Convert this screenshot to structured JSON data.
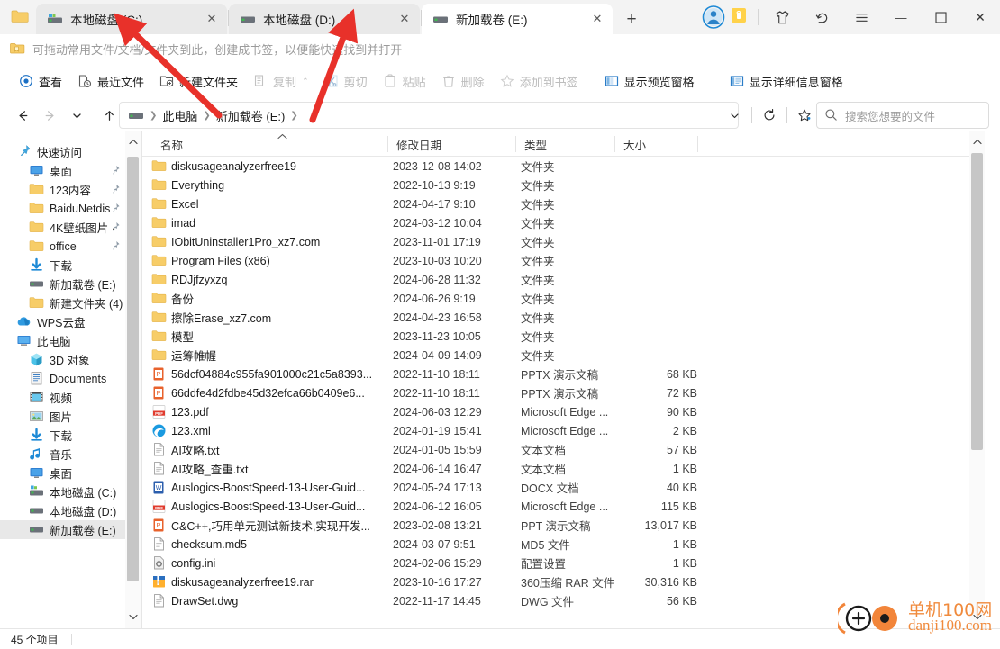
{
  "window": {
    "app_icon": "folder-icon",
    "controls": {
      "clothes": "shirt-icon",
      "undo": "undo-icon",
      "menu": "hamburger-menu-icon",
      "minimize": "—",
      "maximize": "▢",
      "close": "✕"
    }
  },
  "tabs": [
    {
      "label": "本地磁盘 (C:)",
      "icon": "drive-c-icon",
      "active": false,
      "close": "✕"
    },
    {
      "label": "本地磁盘 (D:)",
      "icon": "drive-d-icon",
      "active": false,
      "close": "✕"
    },
    {
      "label": "新加载卷 (E:)",
      "icon": "drive-e-icon",
      "active": true,
      "close": "✕"
    }
  ],
  "new_tab_label": "+",
  "bookmark_bar": {
    "icon": "bookmark-folder-icon",
    "text": "可拖动常用文件/文档/文件夹到此，创建成书签，以便能快速找到并打开"
  },
  "toolbar": [
    {
      "label": "查看",
      "icon": "view-icon",
      "disabled": false,
      "caret": false
    },
    {
      "label": "最近文件",
      "icon": "recent-files-icon",
      "disabled": false,
      "caret": false
    },
    {
      "label": "新建文件夹",
      "icon": "new-folder-icon",
      "disabled": false,
      "caret": false
    },
    {
      "label": "复制",
      "icon": "copy-icon",
      "disabled": true,
      "caret": true
    },
    {
      "label": "剪切",
      "icon": "cut-icon",
      "disabled": true,
      "caret": false
    },
    {
      "label": "粘贴",
      "icon": "paste-icon",
      "disabled": true,
      "caret": false
    },
    {
      "label": "删除",
      "icon": "delete-icon",
      "disabled": true,
      "caret": false
    },
    {
      "label": "添加到书签",
      "icon": "add-bookmark-icon",
      "disabled": true,
      "caret": false
    },
    {
      "label": "显示预览窗格",
      "icon": "preview-pane-icon",
      "disabled": false,
      "caret": false
    },
    {
      "label": "显示详细信息窗格",
      "icon": "details-pane-icon",
      "disabled": false,
      "caret": false
    }
  ],
  "navigation": {
    "back": "←",
    "forward": "→",
    "history": "⌄",
    "up": "↑",
    "breadcrumb": [
      "此电脑",
      "新加载卷 (E:)"
    ],
    "breadcrumb_drive_icon": "drive-icon",
    "address_dropdown": "⌄",
    "refresh": "refresh-icon",
    "bookmark": "bookmark-star-icon"
  },
  "search": {
    "icon": "search-icon",
    "placeholder": "搜索您想要的文件",
    "value": ""
  },
  "sidebar": {
    "items": [
      {
        "label": "快速访问",
        "icon": "quick-access-pin-icon",
        "level": 0,
        "pin": false,
        "selected": false
      },
      {
        "label": "桌面",
        "icon": "desktop-icon",
        "level": 1,
        "pin": true,
        "selected": false
      },
      {
        "label": "123内容",
        "icon": "folder-icon",
        "level": 1,
        "pin": true,
        "selected": false
      },
      {
        "label": "BaiduNetdis",
        "icon": "folder-icon",
        "level": 1,
        "pin": true,
        "selected": false
      },
      {
        "label": "4K壁纸图片 ·",
        "icon": "folder-icon",
        "level": 1,
        "pin": true,
        "selected": false
      },
      {
        "label": "office",
        "icon": "folder-icon",
        "level": 1,
        "pin": true,
        "selected": false
      },
      {
        "label": "下载",
        "icon": "download-icon",
        "level": 1,
        "pin": false,
        "selected": false
      },
      {
        "label": "新加载卷 (E:)",
        "icon": "drive-icon",
        "level": 1,
        "pin": false,
        "selected": false
      },
      {
        "label": "新建文件夹 (4)",
        "icon": "folder-icon",
        "level": 1,
        "pin": false,
        "selected": false
      },
      {
        "label": "WPS云盘",
        "icon": "cloud-icon",
        "level": 0,
        "pin": false,
        "selected": false
      },
      {
        "label": "此电脑",
        "icon": "this-pc-icon",
        "level": 0,
        "pin": false,
        "selected": false
      },
      {
        "label": "3D 对象",
        "icon": "3d-objects-icon",
        "level": 1,
        "pin": false,
        "selected": false
      },
      {
        "label": "Documents",
        "icon": "documents-icon",
        "level": 1,
        "pin": false,
        "selected": false
      },
      {
        "label": "视频",
        "icon": "videos-icon",
        "level": 1,
        "pin": false,
        "selected": false
      },
      {
        "label": "图片",
        "icon": "pictures-icon",
        "level": 1,
        "pin": false,
        "selected": false
      },
      {
        "label": "下载",
        "icon": "download-icon",
        "level": 1,
        "pin": false,
        "selected": false
      },
      {
        "label": "音乐",
        "icon": "music-icon",
        "level": 1,
        "pin": false,
        "selected": false
      },
      {
        "label": "桌面",
        "icon": "desktop-icon",
        "level": 1,
        "pin": false,
        "selected": false
      },
      {
        "label": "本地磁盘 (C:)",
        "icon": "drive-c-icon",
        "level": 1,
        "pin": false,
        "selected": false
      },
      {
        "label": "本地磁盘 (D:)",
        "icon": "drive-d-icon",
        "level": 1,
        "pin": false,
        "selected": false
      },
      {
        "label": "新加载卷 (E:)",
        "icon": "drive-icon",
        "level": 1,
        "pin": false,
        "selected": true
      }
    ]
  },
  "filelist": {
    "columns": [
      "名称",
      "修改日期",
      "类型",
      "大小"
    ],
    "sort_indicator": "▲",
    "rows": [
      {
        "name": "diskusageanalyzerfree19",
        "date": "2023-12-08 14:02",
        "type": "文件夹",
        "size": "",
        "icon": "folder-icon"
      },
      {
        "name": "Everything",
        "date": "2022-10-13 9:19",
        "type": "文件夹",
        "size": "",
        "icon": "folder-icon"
      },
      {
        "name": "Excel",
        "date": "2024-04-17 9:10",
        "type": "文件夹",
        "size": "",
        "icon": "folder-icon"
      },
      {
        "name": "imad",
        "date": "2024-03-12 10:04",
        "type": "文件夹",
        "size": "",
        "icon": "folder-icon"
      },
      {
        "name": "IObitUninstaller1Pro_xz7.com",
        "date": "2023-11-01 17:19",
        "type": "文件夹",
        "size": "",
        "icon": "folder-icon"
      },
      {
        "name": "Program Files (x86)",
        "date": "2023-10-03 10:20",
        "type": "文件夹",
        "size": "",
        "icon": "folder-icon"
      },
      {
        "name": "RDJjfzyxzq",
        "date": "2024-06-28 11:32",
        "type": "文件夹",
        "size": "",
        "icon": "folder-icon"
      },
      {
        "name": "备份",
        "date": "2024-06-26 9:19",
        "type": "文件夹",
        "size": "",
        "icon": "folder-icon"
      },
      {
        "name": "擦除Erase_xz7.com",
        "date": "2024-04-23 16:58",
        "type": "文件夹",
        "size": "",
        "icon": "folder-icon"
      },
      {
        "name": "模型",
        "date": "2023-11-23 10:05",
        "type": "文件夹",
        "size": "",
        "icon": "folder-icon"
      },
      {
        "name": "运筹帷幄",
        "date": "2024-04-09 14:09",
        "type": "文件夹",
        "size": "",
        "icon": "folder-icon"
      },
      {
        "name": "56dcf04884c955fa901000c21c5a8393...",
        "date": "2022-11-10 18:11",
        "type": "PPTX 演示文稿",
        "size": "68 KB",
        "icon": "pptx-icon"
      },
      {
        "name": "66ddfe4d2fdbe45d32efca66b0409e6...",
        "date": "2022-11-10 18:11",
        "type": "PPTX 演示文稿",
        "size": "72 KB",
        "icon": "pptx-icon"
      },
      {
        "name": "123.pdf",
        "date": "2024-06-03 12:29",
        "type": "Microsoft Edge ...",
        "size": "90 KB",
        "icon": "pdf-icon"
      },
      {
        "name": "123.xml",
        "date": "2024-01-19 15:41",
        "type": "Microsoft Edge ...",
        "size": "2 KB",
        "icon": "edge-icon"
      },
      {
        "name": "AI攻略.txt",
        "date": "2024-01-05 15:59",
        "type": "文本文档",
        "size": "57 KB",
        "icon": "txt-icon"
      },
      {
        "name": "AI攻略_查重.txt",
        "date": "2024-06-14 16:47",
        "type": "文本文档",
        "size": "1 KB",
        "icon": "txt-icon"
      },
      {
        "name": "Auslogics-BoostSpeed-13-User-Guid...",
        "date": "2024-05-24 17:13",
        "type": "DOCX 文档",
        "size": "40 KB",
        "icon": "docx-icon"
      },
      {
        "name": "Auslogics-BoostSpeed-13-User-Guid...",
        "date": "2024-06-12 16:05",
        "type": "Microsoft Edge ...",
        "size": "115 KB",
        "icon": "pdf-icon"
      },
      {
        "name": "C&C++,巧用单元测试新技术,实现开发...",
        "date": "2023-02-08 13:21",
        "type": "PPT 演示文稿",
        "size": "13,017 KB",
        "icon": "ppt-icon"
      },
      {
        "name": "checksum.md5",
        "date": "2024-03-07 9:51",
        "type": "MD5 文件",
        "size": "1 KB",
        "icon": "generic-file-icon"
      },
      {
        "name": "config.ini",
        "date": "2024-02-06 15:29",
        "type": "配置设置",
        "size": "1 KB",
        "icon": "ini-icon"
      },
      {
        "name": "diskusageanalyzerfree19.rar",
        "date": "2023-10-16 17:27",
        "type": "360压缩 RAR 文件",
        "size": "30,316 KB",
        "icon": "rar-icon"
      },
      {
        "name": "DrawSet.dwg",
        "date": "2022-11-17 14:45",
        "type": "DWG 文件",
        "size": "56 KB",
        "icon": "generic-file-icon"
      }
    ]
  },
  "statusbar": {
    "item_count": "45 个项目"
  },
  "watermark": {
    "line1": "单机100网",
    "line2": "danji100.com"
  },
  "colors": {
    "accent": "#0078d4",
    "folder": "#f7cd68",
    "annotation": "#e8312a",
    "selected_row": "#e8e8e8"
  }
}
